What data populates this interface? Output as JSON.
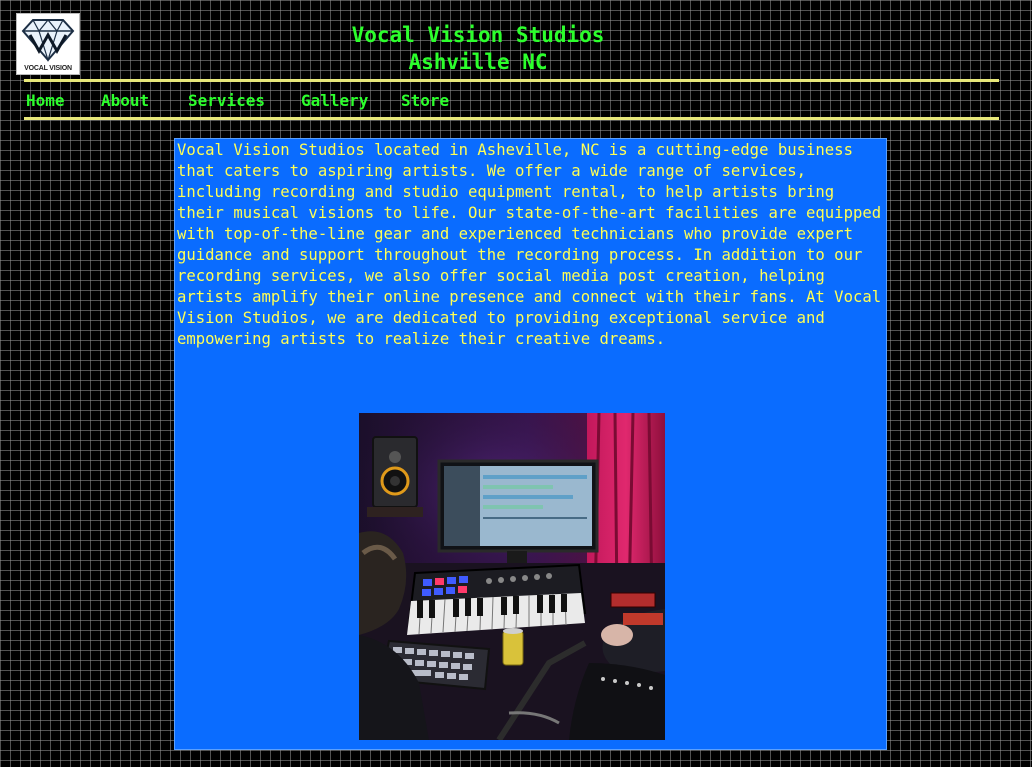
{
  "header": {
    "logo_text": "VOCAL VISION",
    "title": "Vocal Vision Studios",
    "subtitle": "Ashville NC"
  },
  "nav": {
    "items": [
      {
        "label": "Home"
      },
      {
        "label": "About"
      },
      {
        "label": "Services"
      },
      {
        "label": "Gallery"
      },
      {
        "label": "Store"
      }
    ]
  },
  "main": {
    "description": "Vocal Vision Studios located in Asheville, NC is a cutting-edge business that caters to aspiring artists. We offer a wide range of services, including recording and studio equipment rental, to help artists bring their musical visions to life. Our state-of-the-art facilities are equipped with top-of-the-line gear and experienced technicians who provide expert guidance and support throughout the recording process. In addition to our recording services, we also offer social media post creation, helping artists amplify their online presence and connect with their fans. At Vocal Vision Studios, we are dedicated to providing exceptional service and empowering artists to realize their creative dreams."
  },
  "colors": {
    "page_background": "#000000",
    "grid_lines": "#969696",
    "nav_and_title_text": "#2cff2c",
    "divider_rules": "#e8e87a",
    "content_background": "#0a6cff",
    "content_text": "#ffff55"
  }
}
